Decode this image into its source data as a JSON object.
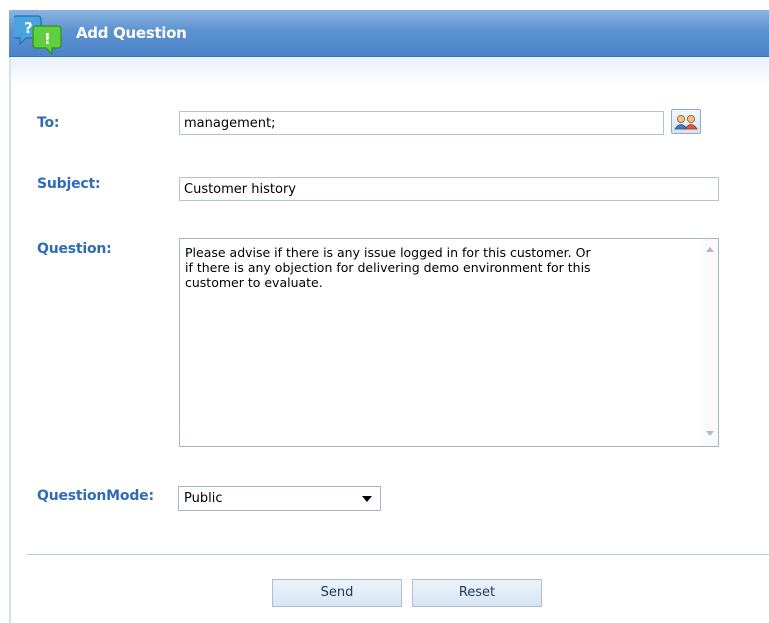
{
  "header": {
    "title": "Add Question",
    "icon": "question-exclamation-bubbles-icon"
  },
  "form": {
    "to": {
      "label": "To:",
      "value": "management;",
      "picker_icon": "address-book-icon"
    },
    "subject": {
      "label": "Subject:",
      "value": "Customer history"
    },
    "question": {
      "label": "Question:",
      "value": "Please advise if there is any issue logged in for this customer. Or\nif there is any objection for delivering demo environment for this\ncustomer to evaluate."
    },
    "question_mode": {
      "label": "QuestionMode:",
      "selected": "Public"
    }
  },
  "actions": {
    "send_label": "Send",
    "reset_label": "Reset"
  },
  "colors": {
    "header": "#5d92d0",
    "label": "#2e6db4"
  }
}
